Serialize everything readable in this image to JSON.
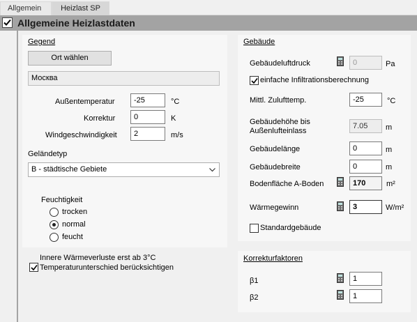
{
  "tabs": [
    {
      "label": "Allgemein"
    },
    {
      "label": "Heizlast SP"
    }
  ],
  "section": {
    "title": "Allgemeine Heizlastdaten",
    "checked": true
  },
  "gegend": {
    "title": "Gegend",
    "ort_button": "Ort wählen",
    "ort_value": "Москва",
    "aussentemp": {
      "label": "Außentemperatur",
      "value": "-25",
      "unit": "°C"
    },
    "korrektur": {
      "label": "Korrektur",
      "value": "0",
      "unit": "K"
    },
    "wind": {
      "label": "Windgeschwindigkeit",
      "value": "2",
      "unit": "m/s"
    },
    "gelaendetyp_label": "Geländetyp",
    "gelaendetyp_value": "B - städtische Gebiete",
    "feuchtigkeit": {
      "label": "Feuchtigkeit",
      "options": [
        "trocken",
        "normal",
        "feucht"
      ],
      "selected": "normal"
    }
  },
  "left_options": {
    "innere_line1": "Innere Wärmeverluste erst ab 3°C",
    "innere_line2": "Temperaturunterschied berücksichtigen",
    "checked": true
  },
  "gebaeude": {
    "title": "Gebäude",
    "luftdruck": {
      "label": "Gebäudeluftdruck",
      "value": "0",
      "unit": "Pa"
    },
    "infiltration": {
      "label": "einfache Infiltrationsberechnung",
      "checked": true
    },
    "zuluft": {
      "label": "Mittl. Zulufttemp.",
      "value": "-25",
      "unit": "°C"
    },
    "hoehe": {
      "label_line1": "Gebäudehöhe bis",
      "label_line2": "Außenlufteinlass",
      "value": "7.05",
      "unit": "m"
    },
    "laenge": {
      "label": "Gebäudelänge",
      "value": "0",
      "unit": "m"
    },
    "breite": {
      "label": "Gebäudebreite",
      "value": "0",
      "unit": "m"
    },
    "bodenflaeche": {
      "label": "Bodenfläche A-Boden",
      "value": "170",
      "unit": "m²"
    },
    "waermegewinn": {
      "label": "Wärmegewinn",
      "value": "3",
      "unit": "W/m²"
    },
    "standard": {
      "label": "Standardgebäude",
      "checked": false
    }
  },
  "korrektur_faktoren": {
    "title": "Korrekturfaktoren",
    "beta1": {
      "label": "β1",
      "value": "1"
    },
    "beta2": {
      "label": "β2",
      "value": "1"
    }
  }
}
